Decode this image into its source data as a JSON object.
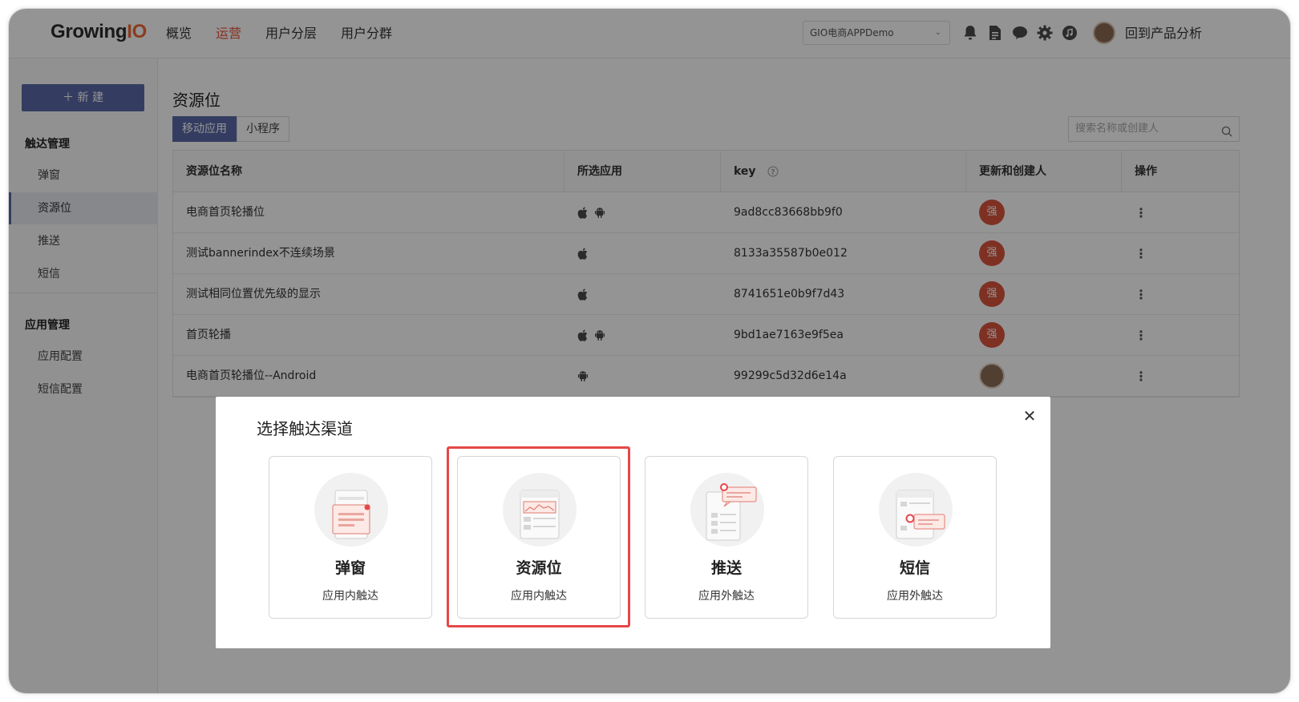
{
  "header": {
    "logo_main": "Growing",
    "logo_accent": "IO",
    "nav": [
      "概览",
      "运营",
      "用户分层",
      "用户分群"
    ],
    "active_nav": "运营",
    "app_select": "GIO电商APPDemo",
    "back_link": "回到产品分析",
    "icons": [
      "bell-icon",
      "document-icon",
      "chat-icon",
      "settings-icon",
      "music-icon"
    ]
  },
  "sidebar": {
    "new_button": "＋ 新 建",
    "group1": "触达管理",
    "group1_items": [
      "弹窗",
      "资源位",
      "推送",
      "短信"
    ],
    "active_item": "资源位",
    "group2": "应用管理",
    "group2_items": [
      "应用配置",
      "短信配置"
    ]
  },
  "main": {
    "title": "资源位",
    "tabs": [
      "移动应用",
      "小程序"
    ],
    "active_tab": "移动应用",
    "search_placeholder": "搜索名称或创建人",
    "columns": [
      "资源位名称",
      "所选应用",
      "key",
      "更新和创建人",
      "操作"
    ],
    "rows": [
      {
        "name": "电商首页轮播位",
        "platforms": [
          "ios",
          "android"
        ],
        "key": "9ad8cc83668bb9f0",
        "creator": "强",
        "creator_type": "letter"
      },
      {
        "name": "测试bannerindex不连续场景",
        "platforms": [
          "ios"
        ],
        "key": "8133a35587b0e012",
        "creator": "强",
        "creator_type": "letter"
      },
      {
        "name": "测试相同位置优先级的显示",
        "platforms": [
          "ios"
        ],
        "key": "8741651e0b9f7d43",
        "creator": "强",
        "creator_type": "letter"
      },
      {
        "name": "首页轮播",
        "platforms": [
          "ios",
          "android"
        ],
        "key": "9bd1ae7163e9f5ea",
        "creator": "强",
        "creator_type": "letter"
      },
      {
        "name": "电商首页轮播位--Android",
        "platforms": [
          "android"
        ],
        "key": "99299c5d32d6e14a",
        "creator": "",
        "creator_type": "photo"
      }
    ],
    "more_glyph": "⋮"
  },
  "modal": {
    "title": "选择触达渠道",
    "close": "✕",
    "cards": [
      {
        "title": "弹窗",
        "subtitle": "应用内触达"
      },
      {
        "title": "资源位",
        "subtitle": "应用内触达"
      },
      {
        "title": "推送",
        "subtitle": "应用外触达"
      },
      {
        "title": "短信",
        "subtitle": "应用外触达"
      }
    ],
    "highlighted_card": "资源位"
  },
  "colors": {
    "accent": "#5b6aa7",
    "nav_active": "#e8553c",
    "badge": "#d9553d",
    "highlight": "#e54848"
  }
}
